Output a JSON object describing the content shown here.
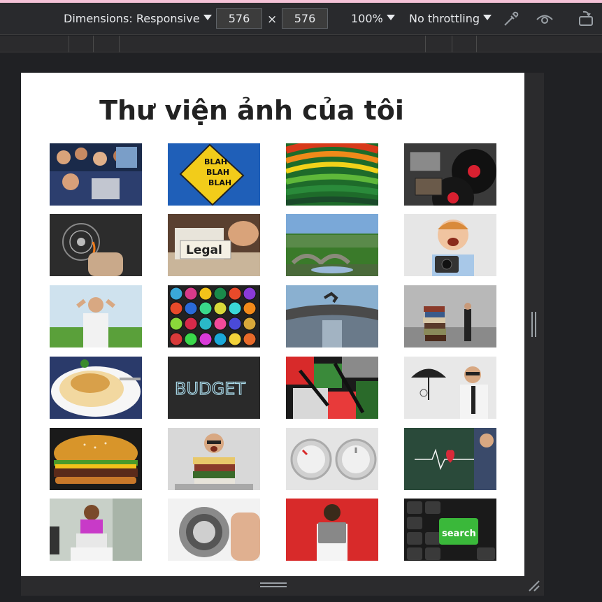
{
  "toolbar": {
    "dimensions_label": "Dimensions: Responsive",
    "width_value": "576",
    "height_value": "576",
    "times_symbol": "×",
    "zoom_label": "100%",
    "throttle_label": "No throttling",
    "icons": [
      "eyedropper-icon",
      "eye-icon",
      "rotate-icon"
    ]
  },
  "page": {
    "title": "Thư viện ảnh của tôi",
    "gallery": [
      {
        "subject": "crowd concert"
      },
      {
        "subject": "blah blah sign"
      },
      {
        "subject": "colorful swirl lines"
      },
      {
        "subject": "vinyl records cassette"
      },
      {
        "subject": "hand touch interface"
      },
      {
        "subject": "legal folder"
      },
      {
        "subject": "landscape stone bridge"
      },
      {
        "subject": "boy with camera"
      },
      {
        "subject": "man relaxing field"
      },
      {
        "subject": "spray paint cans"
      },
      {
        "subject": "man jumping bridge"
      },
      {
        "subject": "books stack man"
      },
      {
        "subject": "pasta plate"
      },
      {
        "subject": "budget chalkboard"
      },
      {
        "subject": "graffiti wall"
      },
      {
        "subject": "man umbrella sketch"
      },
      {
        "subject": "burger"
      },
      {
        "subject": "man paperwork pile"
      },
      {
        "subject": "knobs dials"
      },
      {
        "subject": "heartbeat chalkboard"
      },
      {
        "subject": "woman laptop"
      },
      {
        "subject": "safe dial lock"
      },
      {
        "subject": "man laptop red background"
      },
      {
        "subject": "search keyboard key"
      }
    ],
    "thumb_texts": {
      "blah": "BLAH",
      "legal": "Legal",
      "budget": "BUDGET",
      "search": "search"
    }
  }
}
